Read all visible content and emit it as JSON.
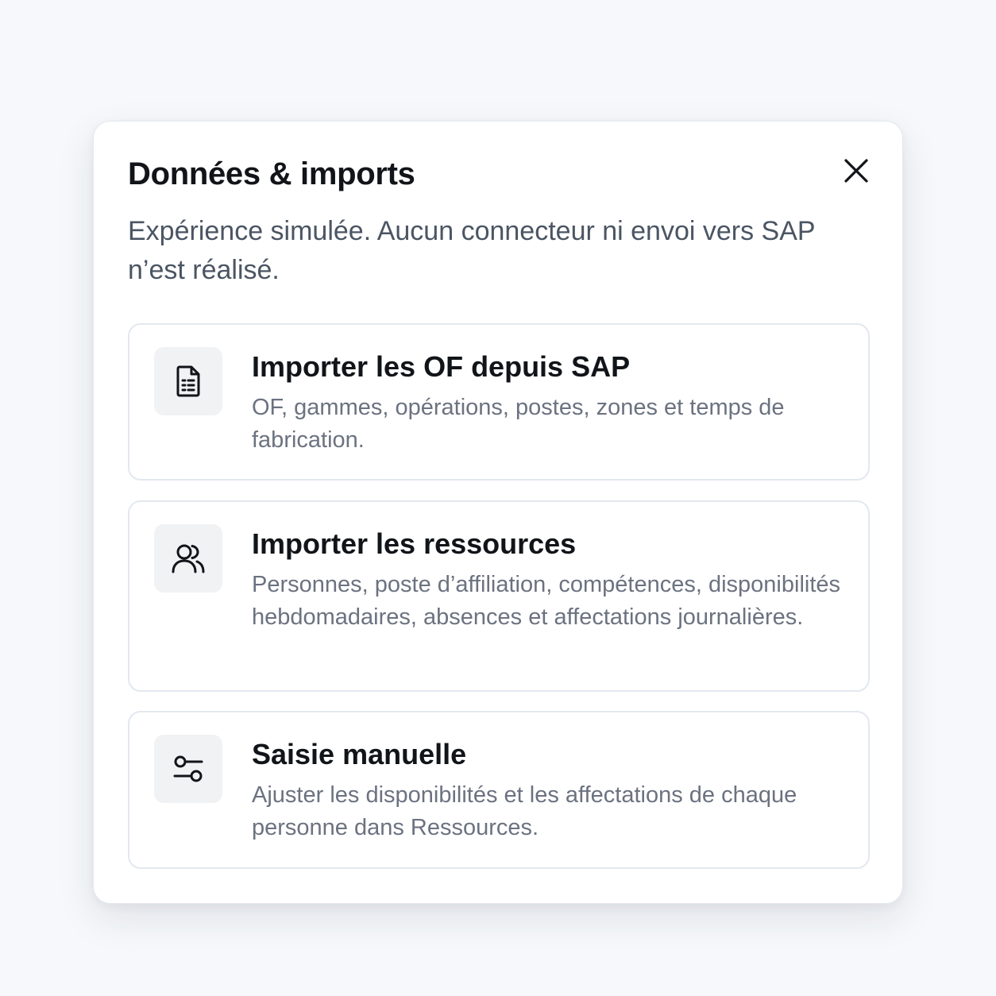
{
  "dialog": {
    "title": "Données & imports",
    "subtitle": "Expérience simulée. Aucun connecteur ni envoi vers SAP n’est réalisé.",
    "close_icon": "close-icon"
  },
  "options": [
    {
      "icon": "document-table-icon",
      "title": "Importer les OF depuis SAP",
      "description": "OF, gammes, opérations, postes, zones et temps de fabrication."
    },
    {
      "icon": "users-icon",
      "title": "Importer les ressources",
      "description": "Personnes, poste d’affiliation, compétences, disponibilités hebdomadaires, absences et affectations journalières."
    },
    {
      "icon": "sliders-icon",
      "title": "Saisie manuelle",
      "description": "Ajuster les disponibilités et les affectations de chaque personne dans Ressources."
    }
  ],
  "colors": {
    "background": "#f6f8fb",
    "title": "#111418",
    "subtitle": "#4b5563",
    "description": "#6b7280",
    "card_border": "#e3e8ef",
    "icon_tile": "#f1f2f4"
  }
}
